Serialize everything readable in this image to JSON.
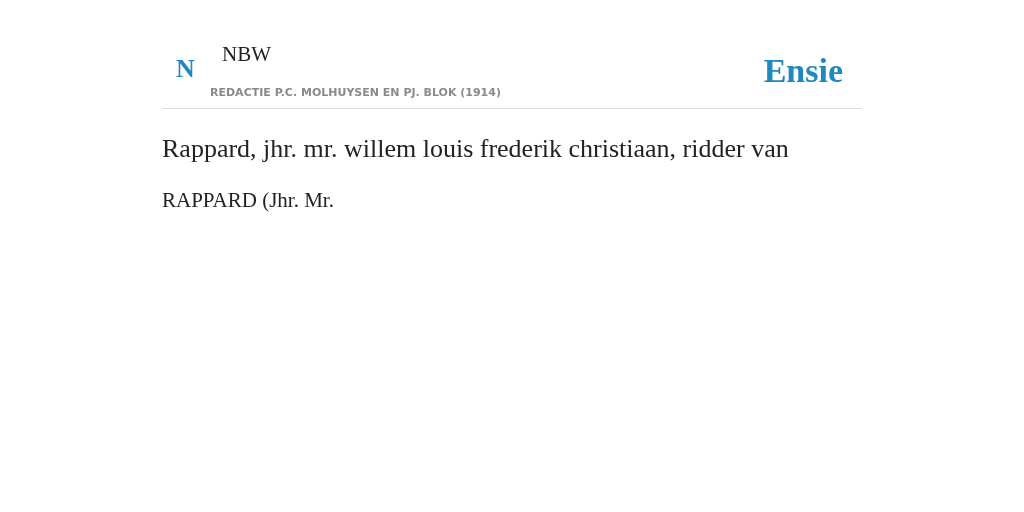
{
  "header": {
    "logo_letter": "N",
    "source": "NBW",
    "editors": "REDACTIE P.C. MOLHUYSEN EN PJ. BLOK (1914)",
    "brand": "Ensie"
  },
  "article": {
    "title": "Rappard, jhr. mr. willem louis frederik christiaan, ridder van",
    "body": "RAPPARD (Jhr. Mr."
  }
}
